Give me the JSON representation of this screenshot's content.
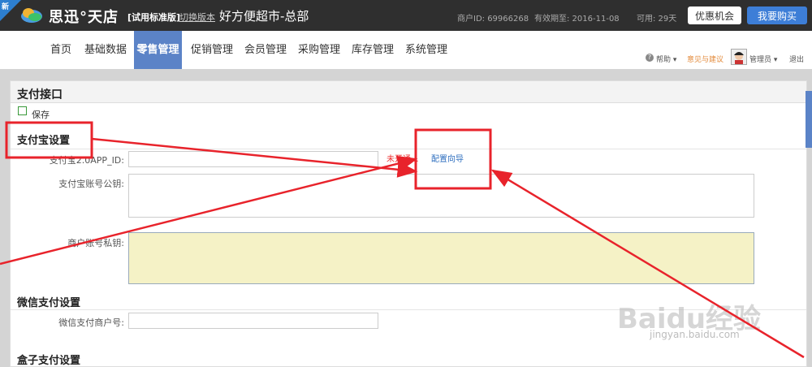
{
  "header": {
    "new_badge": "新",
    "brand": "思迅°天店",
    "edition": "[试用标准版]",
    "switch_version": "切换版本",
    "store_name": "好方便超市-总部",
    "merchant_id": "商户ID: 69966268",
    "valid_until": "有效期至: 2016-11-08",
    "available": "可用: 29天",
    "offer_button": "优惠机会",
    "buy_button": "我要购买"
  },
  "nav": {
    "items": [
      "首页",
      "基础数据",
      "零售管理",
      "促销管理",
      "会员管理",
      "采购管理",
      "库存管理",
      "系统管理"
    ],
    "active_index": 2,
    "help": "帮助 ▾",
    "feedback": "意见与建议",
    "admin": "管理员 ▾",
    "logout": "退出"
  },
  "panel": {
    "title": "支付接口",
    "save": "保存",
    "alipay": {
      "section_title": "支付宝设置",
      "app_id_label": "支付宝2.0APP_ID:",
      "app_id_value": "",
      "status": "未开通...",
      "config_link": "配置向导",
      "public_key_label": "支付宝账号公钥:",
      "private_key_label": "商户账号私钥:"
    },
    "wechat": {
      "section_title": "微信支付设置",
      "merchant_label": "微信支付商户号:"
    },
    "box": {
      "section_title": "盒子支付设置"
    }
  },
  "watermark": {
    "logo": "Baidu经验",
    "url": "jingyan.baidu.com"
  },
  "colors": {
    "topbar": "#2f2f2f",
    "accent": "#5b83c7",
    "annotation": "#e8232b"
  }
}
